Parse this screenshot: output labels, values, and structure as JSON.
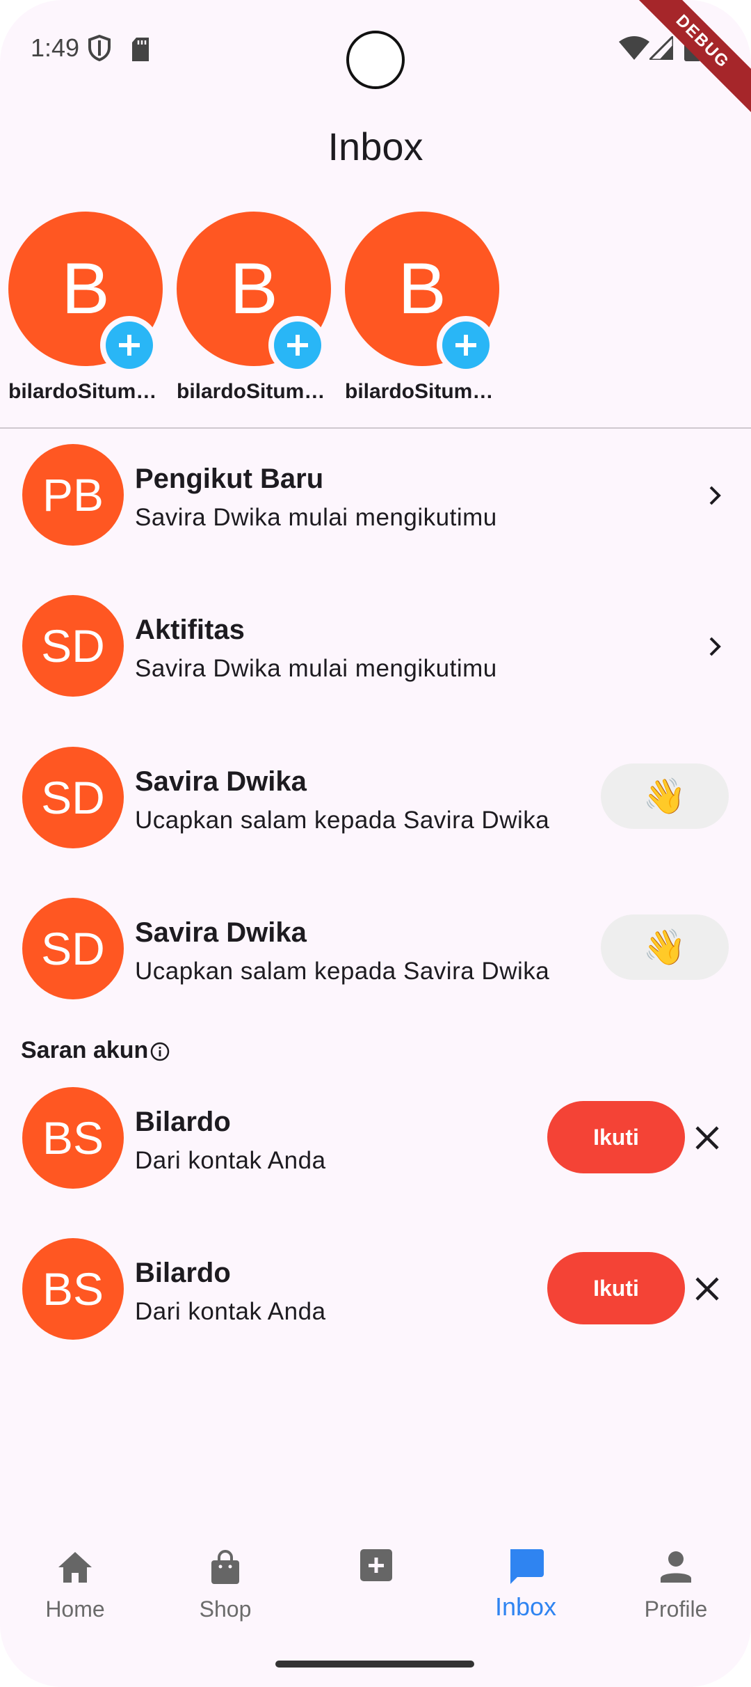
{
  "status_bar": {
    "time": "1:49",
    "debug_label": "DEBUG",
    "icons": [
      "shield-icon",
      "sd-card-icon",
      "wifi-icon",
      "signal-icon",
      "battery-icon"
    ]
  },
  "header": {
    "title": "Inbox"
  },
  "stories": [
    {
      "initial": "B",
      "name": "bilardoSitumorang"
    },
    {
      "initial": "B",
      "name": "bilardoSitumorang"
    },
    {
      "initial": "B",
      "name": "bilardoSitumorang"
    }
  ],
  "notifications": [
    {
      "initials": "PB",
      "title": "Pengikut Baru",
      "subtitle": "Savira Dwika mulai mengikutimu",
      "action": "chevron"
    },
    {
      "initials": "SD",
      "title": "Aktifitas",
      "subtitle": "Savira Dwika mulai mengikutimu",
      "action": "chevron"
    },
    {
      "initials": "SD",
      "title": "Savira Dwika",
      "subtitle": "Ucapkan salam kepada Savira Dwika",
      "action": "wave",
      "wave_emoji": "👋"
    },
    {
      "initials": "SD",
      "title": "Savira Dwika",
      "subtitle": "Ucapkan salam kepada Savira Dwika",
      "action": "wave",
      "wave_emoji": "👋"
    }
  ],
  "suggestions": {
    "title": "Saran akun",
    "items": [
      {
        "initials": "BS",
        "name": "Bilardo",
        "subtitle": "Dari kontak Anda",
        "follow_label": "Ikuti"
      },
      {
        "initials": "BS",
        "name": "Bilardo",
        "subtitle": "Dari kontak Anda",
        "follow_label": "Ikuti"
      }
    ]
  },
  "bottom_nav": {
    "items": [
      {
        "label": "Home",
        "icon": "home-icon"
      },
      {
        "label": "Shop",
        "icon": "shopping-bag-icon"
      },
      {
        "label": "",
        "icon": "add-box-icon"
      },
      {
        "label": "Inbox",
        "icon": "chat-icon",
        "active": true
      },
      {
        "label": "Profile",
        "icon": "person-icon"
      }
    ]
  },
  "colors": {
    "background": "#fdf6fd",
    "avatar": "#ff5722",
    "add_badge": "#29b6f6",
    "follow_button": "#f44336",
    "active_nav": "#2f84f1"
  }
}
